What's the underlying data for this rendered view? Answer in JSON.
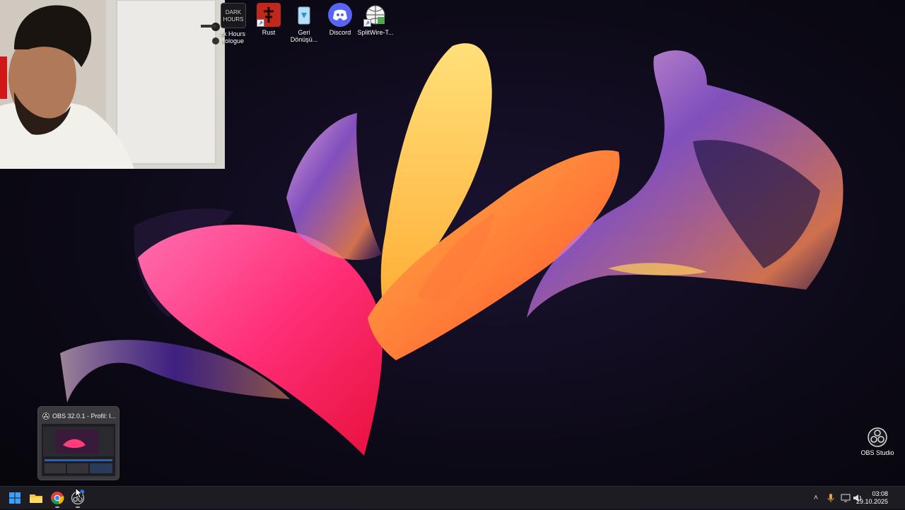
{
  "desktop_icons": [
    {
      "label": "Dark Hours Prologue",
      "visible_label_line1": "rk Hours",
      "visible_label_line2": "rologue",
      "icon": "dark-hours-icon"
    },
    {
      "label": "Rust",
      "icon": "rust-icon"
    },
    {
      "label": "Geri Dönüşü...",
      "label_line1": "Geri",
      "label_line2": "Dönüşü...",
      "icon": "recycle-bin-icon"
    },
    {
      "label": "Discord",
      "icon": "discord-icon"
    },
    {
      "label": "SplitWire-T...",
      "icon": "splitwire-icon"
    }
  ],
  "obs_preview": {
    "title": "OBS 32.0.1 - Profil: I...",
    "icon": "obs-icon"
  },
  "obs_shortcut": {
    "label": "OBS Studio",
    "icon": "obs-icon"
  },
  "taskbar": {
    "apps": [
      {
        "name": "Start",
        "icon": "windows-start-icon"
      },
      {
        "name": "File Explorer",
        "icon": "folder-icon"
      },
      {
        "name": "Google Chrome",
        "icon": "chrome-icon"
      },
      {
        "name": "OBS Studio",
        "icon": "obs-icon"
      }
    ],
    "tray": {
      "icons": [
        "chevron-up-icon",
        "microphone-icon",
        "display-icon",
        "speaker-icon"
      ]
    },
    "clock": {
      "time": "03:08",
      "date": "29.10.2025"
    }
  },
  "colors": {
    "taskbar_bg": "#1c1c22",
    "wallpaper_pink": "#ff2f78",
    "wallpaper_orange": "#ff8a2a",
    "wallpaper_yellow": "#ffd35a",
    "wallpaper_purple": "#7a3cff"
  }
}
